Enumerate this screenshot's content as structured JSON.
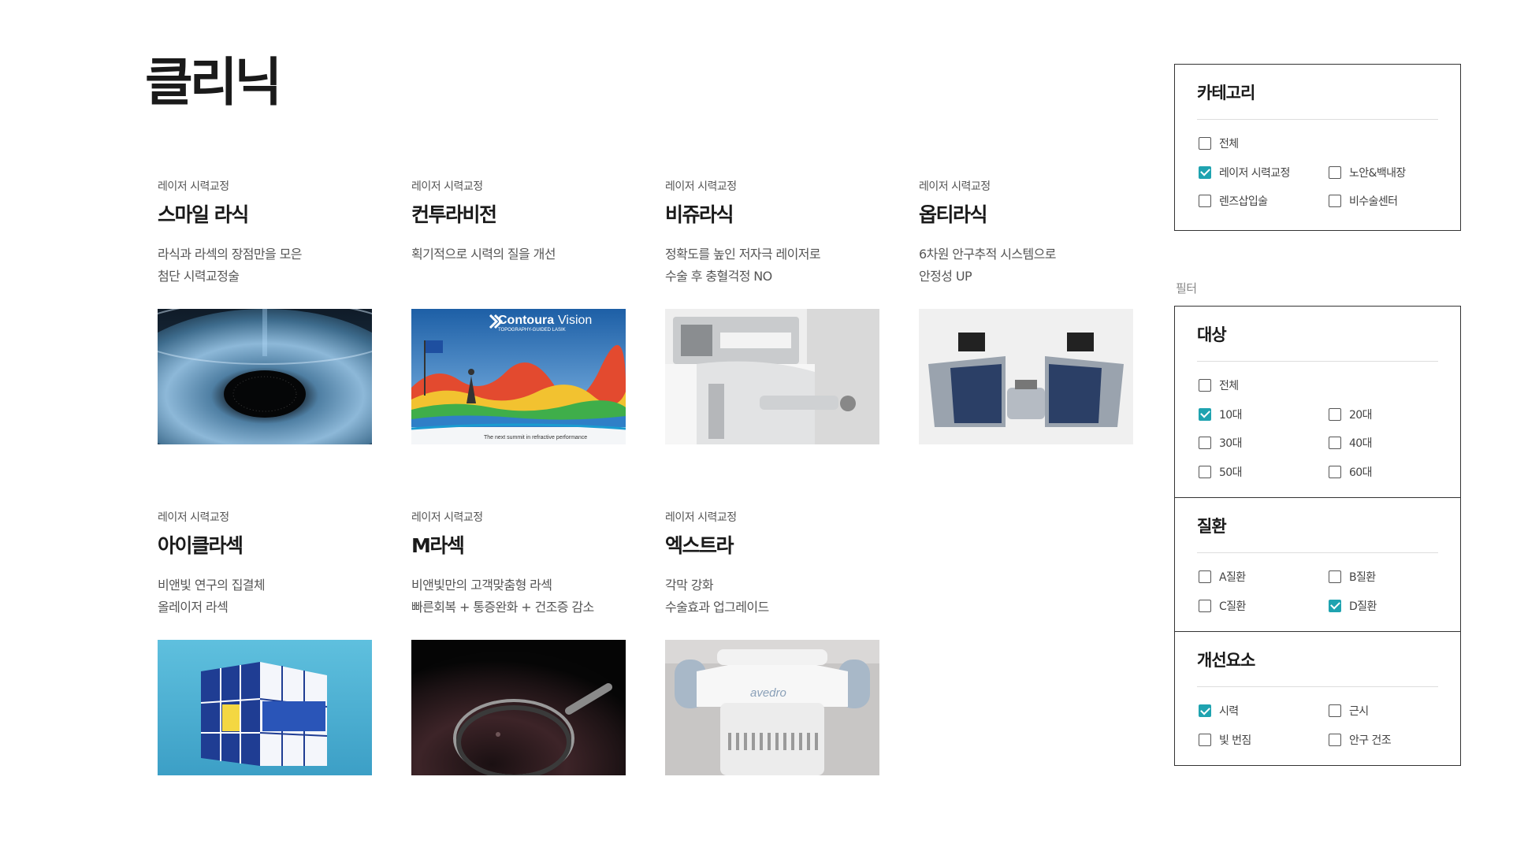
{
  "page": {
    "title": "클리닉",
    "filter_label": "필터"
  },
  "cards": [
    {
      "category": "레이저 시력교정",
      "name": "스마일 라식",
      "desc": [
        "라식과 라섹의 장점만을 모은",
        "첨단 시력교정술"
      ],
      "image": "eye-iris-laser"
    },
    {
      "category": "레이저 시력교정",
      "name": "컨투라비전",
      "desc": [
        "획기적으로 시력의 질을 개선"
      ],
      "image": "contoura-vision-banner",
      "banner": {
        "brand": "Contoura",
        "brand2": "Vision",
        "sub": "TOPOGRAPHY-GUIDED LASIK",
        "tagline": "The next summit in refractive performance"
      }
    },
    {
      "category": "레이저 시력교정",
      "name": "비쥬라식",
      "desc": [
        "정확도를 높인 저자극 레이저로",
        "수술 후 충혈걱정 NO"
      ],
      "image": "laser-machine"
    },
    {
      "category": "레이저 시력교정",
      "name": "옵티라식",
      "desc": [
        "6차원 안구추적 시스템으로",
        "안정성 UP"
      ],
      "image": "laser-workstation"
    },
    {
      "category": "레이저 시력교정",
      "name": "아이클라섹",
      "desc": [
        "비앤빛 연구의 집결체",
        "올레이저 라섹"
      ],
      "image": "cube-graphic"
    },
    {
      "category": "레이저 시력교정",
      "name": "M라섹",
      "desc": [
        "비앤빛만의 고객맞춤형 라섹",
        "빠른회복 + 통증완화 + 건조증 감소"
      ],
      "image": "dark-eye-lens"
    },
    {
      "category": "레이저 시력교정",
      "name": "엑스트라",
      "desc": [
        "각막 강화",
        "수술효과 업그레이드"
      ],
      "image": "avedro-device",
      "brand": "avedro"
    }
  ],
  "category_box": {
    "title": "카테고리",
    "options": [
      {
        "label": "전체",
        "checked": false,
        "full": true
      },
      {
        "label": "레이저 시력교정",
        "checked": true
      },
      {
        "label": "노안&백내장",
        "checked": false
      },
      {
        "label": "렌즈삽입술",
        "checked": false
      },
      {
        "label": "비수술센터",
        "checked": false
      }
    ]
  },
  "filter_box": [
    {
      "title": "대상",
      "options": [
        {
          "label": "전체",
          "checked": false,
          "full": true
        },
        {
          "label": "10대",
          "checked": true
        },
        {
          "label": "20대",
          "checked": false
        },
        {
          "label": "30대",
          "checked": false
        },
        {
          "label": "40대",
          "checked": false
        },
        {
          "label": "50대",
          "checked": false
        },
        {
          "label": "60대",
          "checked": false
        }
      ]
    },
    {
      "title": "질환",
      "options": [
        {
          "label": "A질환",
          "checked": false
        },
        {
          "label": "B질환",
          "checked": false
        },
        {
          "label": "C질환",
          "checked": false
        },
        {
          "label": "D질환",
          "checked": true
        }
      ]
    },
    {
      "title": "개선요소",
      "options": [
        {
          "label": "시력",
          "checked": true
        },
        {
          "label": "근시",
          "checked": false
        },
        {
          "label": "빛 번짐",
          "checked": false
        },
        {
          "label": "안구 건조",
          "checked": false
        }
      ]
    }
  ],
  "colors": {
    "accent": "#1fa3b0",
    "border": "#333333",
    "text": "#1a1a1a"
  }
}
